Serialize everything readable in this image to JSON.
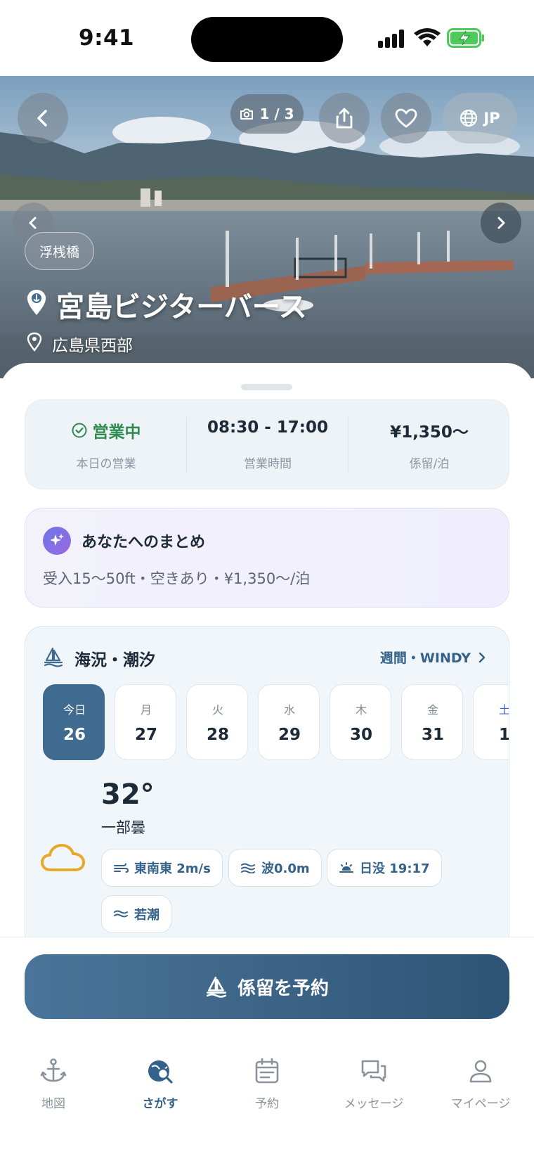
{
  "status_bar": {
    "time": "9:41"
  },
  "hero": {
    "photo_counter": "1 / 3",
    "language": "JP",
    "tag": "浮桟橋",
    "title": "宮島ビジターバース",
    "location": "広島県西部"
  },
  "info": {
    "status_value": "営業中",
    "status_label": "本日の営業",
    "hours_value": "08:30 - 17:00",
    "hours_label": "営業時間",
    "price_value": "¥1,350〜",
    "price_label": "係留/泊",
    "status_color": "#2e8b4f"
  },
  "summary": {
    "title": "あなたへのまとめ",
    "body": "受入15〜50ft・空きあり・¥1,350〜/泊"
  },
  "sea": {
    "title": "海況・潮汐",
    "link": "週間・WINDY",
    "days": [
      {
        "weekday": "今日",
        "date": "26",
        "active": true
      },
      {
        "weekday": "月",
        "date": "27"
      },
      {
        "weekday": "火",
        "date": "28"
      },
      {
        "weekday": "水",
        "date": "29"
      },
      {
        "weekday": "木",
        "date": "30"
      },
      {
        "weekday": "金",
        "date": "31"
      },
      {
        "weekday": "土",
        "date": "1"
      }
    ],
    "temperature": "32°",
    "condition": "一部曇",
    "chips": {
      "wind": "東南東 2m/s",
      "wave": "波0.0m",
      "sunset": "日没 19:17",
      "tide": "若潮"
    },
    "weather_icon": "cloud-icon"
  },
  "cta": {
    "label": "係留を予約"
  },
  "tabbar": {
    "items": [
      {
        "label": "地図",
        "icon": "anchor-icon"
      },
      {
        "label": "さがす",
        "icon": "search-map-icon",
        "active": true
      },
      {
        "label": "予約",
        "icon": "calendar-icon"
      },
      {
        "label": "メッセージ",
        "icon": "message-icon"
      },
      {
        "label": "マイページ",
        "icon": "person-icon"
      }
    ]
  },
  "colors": {
    "accent": "#34628a",
    "primary_button": "#3e6b8f"
  }
}
